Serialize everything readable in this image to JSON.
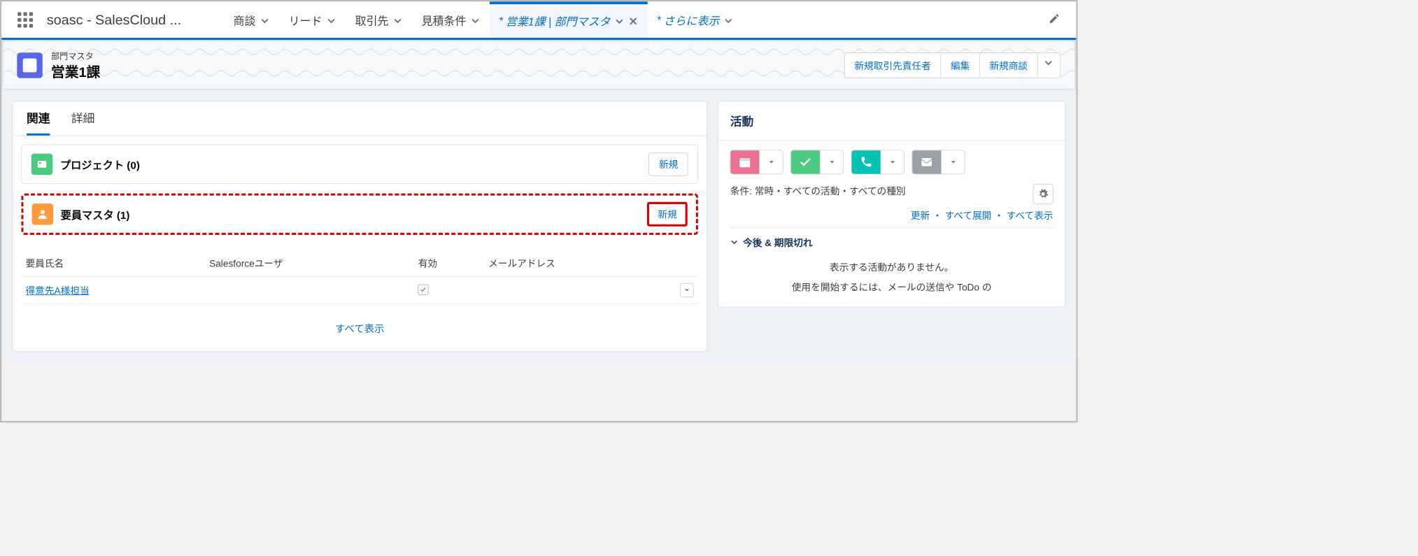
{
  "nav": {
    "app_name": "soasc - SalesCloud ...",
    "tabs": [
      {
        "label": "商談"
      },
      {
        "label": "リード"
      },
      {
        "label": "取引先"
      },
      {
        "label": "見積条件"
      }
    ],
    "active_tab": {
      "label": "営業1課 | 部門マスタ"
    },
    "more_tab": {
      "label": "さらに表示"
    }
  },
  "header": {
    "object_type": "部門マスタ",
    "record_name": "営業1課",
    "buttons": {
      "new_contact": "新規取引先責任者",
      "edit": "編集",
      "new_opportunity": "新規商談"
    }
  },
  "left": {
    "tabs": {
      "related": "関連",
      "detail": "詳細"
    },
    "project_card": {
      "title": "プロジェクト (0)",
      "new_btn": "新規"
    },
    "member_card": {
      "title": "要員マスタ (1)",
      "new_btn": "新規",
      "columns": {
        "name": "要員氏名",
        "sfuser": "Salesforceユーザ",
        "active": "有効",
        "email": "メールアドレス"
      },
      "rows": [
        {
          "name": "得意先A様担当",
          "sfuser": "",
          "active": true,
          "email": ""
        }
      ],
      "show_all": "すべて表示"
    }
  },
  "right": {
    "title": "活動",
    "filter_label": "条件:",
    "filter_value": "常時・すべての活動・すべての種別",
    "links": {
      "refresh": "更新",
      "expand": "すべて展開",
      "showall": "すべて表示"
    },
    "accordion": "今後 & 期限切れ",
    "empty1": "表示する活動がありません。",
    "empty2": "使用を開始するには、メールの送信や ToDo の"
  }
}
